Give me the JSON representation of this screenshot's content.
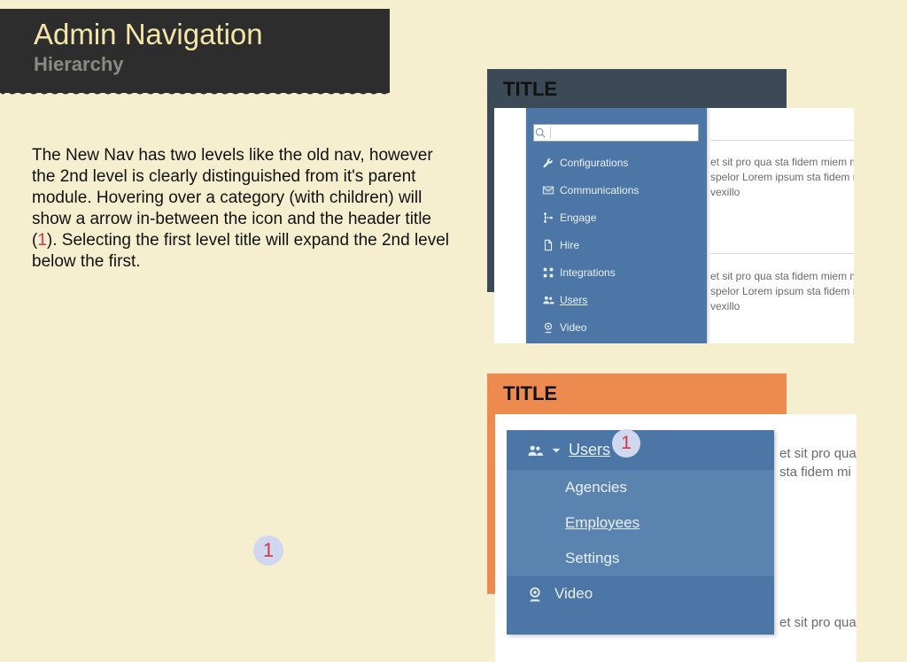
{
  "header": {
    "title": "Admin Navigation",
    "subtitle": "Hierarchy"
  },
  "body": {
    "p1a": "The New Nav has two levels like the old nav, however the 2nd level is clearly distinguished from it's parent module. Hovering over a category (with children) will show a arrow in-between the icon and the header title (",
    "mark1": "1",
    "p1b": "). Selecting the first level title will expand the 2nd level below the first."
  },
  "card1": {
    "title": "TITLE",
    "search_placeholder": "",
    "nav": {
      "0": {
        "label": "Configurations"
      },
      "1": {
        "label": "Communications"
      },
      "2": {
        "label": "Engage"
      },
      "3": {
        "label": "Hire"
      },
      "4": {
        "label": "Integrations"
      },
      "5": {
        "label": "Users"
      },
      "6": {
        "label": "Video"
      }
    },
    "lorem1": "et sit pro qua sta fidem miem m ipsum spelor Lorem ipsum sta fidem miem obligo vexillo",
    "lorem2": "et sit pro qua sta fidem miem m ipsum spelor Lorem ipsum sta fidem miem obligo vexillo"
  },
  "card2": {
    "title": "TITLE",
    "head": {
      "label": "Users"
    },
    "sub": {
      "0": {
        "label": "Agencies"
      },
      "1": {
        "label": "Employees"
      },
      "2": {
        "label": "Settings"
      }
    },
    "video": {
      "label": "Video"
    },
    "callout": "1",
    "lorem1": "et sit pro qua m ipsum spe sta fidem mi",
    "lorem2": "et sit pro qua"
  },
  "floating_callout": "1"
}
